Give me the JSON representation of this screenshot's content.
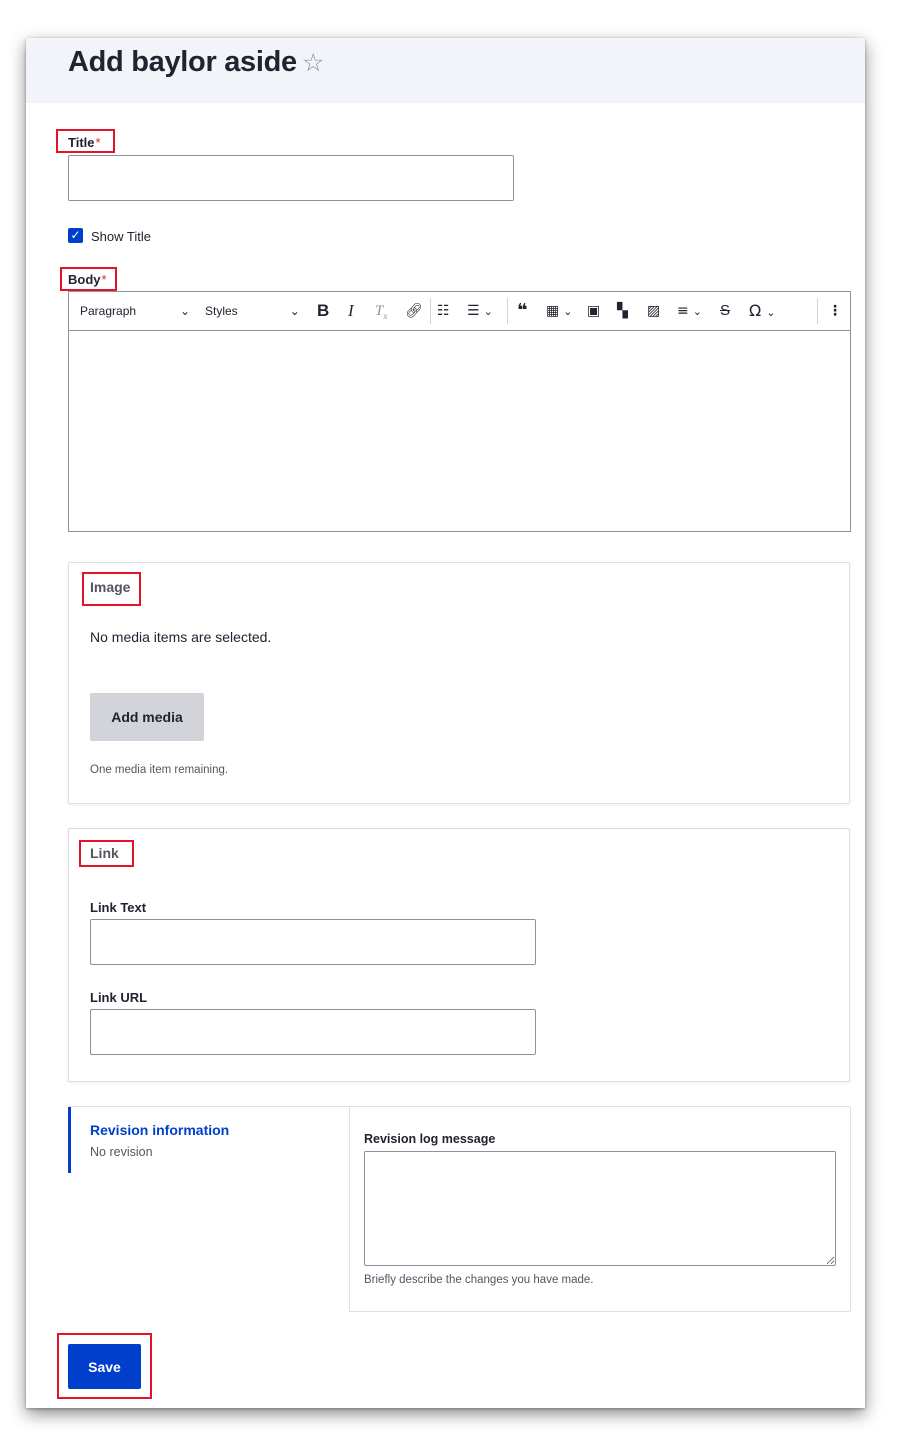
{
  "page": {
    "title": "Add baylor aside",
    "star": "☆"
  },
  "form": {
    "title_label": "Title",
    "required_mark": "*",
    "title_value": "",
    "show_title_label": "Show Title",
    "show_title_checked": true,
    "body_label": "Body"
  },
  "editor": {
    "paragraph_label": "Paragraph",
    "styles_label": "Styles",
    "toolbar_icons": [
      "bold-icon",
      "italic-icon",
      "remove-format-icon",
      "link-icon",
      "bulleted-list-icon",
      "numbered-list-icon",
      "block-quote-icon",
      "table-icon",
      "media-icon",
      "layout-icon",
      "image-icon",
      "align-icon",
      "strikethrough-icon",
      "special-characters-icon",
      "more-options-icon"
    ]
  },
  "image_section": {
    "legend": "Image",
    "empty_message": "No media items are selected.",
    "add_button": "Add media",
    "remaining": "One media item remaining."
  },
  "link_section": {
    "legend": "Link",
    "link_text_label": "Link Text",
    "link_text_value": "",
    "link_url_label": "Link URL",
    "link_url_value": ""
  },
  "revision": {
    "tab_title": "Revision information",
    "tab_summary": "No revision",
    "log_label": "Revision log message",
    "log_value": "",
    "log_description": "Briefly describe the changes you have made."
  },
  "actions": {
    "save_label": "Save"
  },
  "colors": {
    "primary": "#003ecc",
    "annotation": "#e3132a",
    "header_bg": "#f3f4f9"
  }
}
